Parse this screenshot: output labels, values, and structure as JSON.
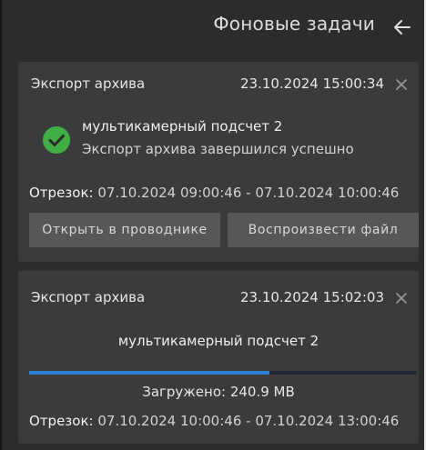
{
  "header": {
    "title": "Фоновые задачи",
    "back_icon": "arrow-left-icon"
  },
  "tasks": [
    {
      "title": "Экспорт архива",
      "timestamp": "23.10.2024 15:00:34",
      "close_icon": "close-icon",
      "status_icon": "check-circle-icon",
      "status_color": "#3fae45",
      "name": "мультикамерный подсчет 2",
      "message": "Экспорт архива завершился успешно",
      "segment_label": "Отрезок:",
      "segment_range": "07.10.2024 09:00:46 - 07.10.2024 10:00:46",
      "buttons": {
        "open": "Открыть в проводнике",
        "play": "Воспроизвести файл"
      }
    },
    {
      "title": "Экспорт архива",
      "timestamp": "23.10.2024 15:02:03",
      "close_icon": "close-icon",
      "name": "мультикамерный подсчет 2",
      "progress": 0.62,
      "progress_color": "#2d7fd4",
      "loaded": "Загружено: 240.9 MB",
      "segment_label": "Отрезок:",
      "segment_range": "07.10.2024 10:00:46 - 07.10.2024 13:00:46"
    }
  ]
}
